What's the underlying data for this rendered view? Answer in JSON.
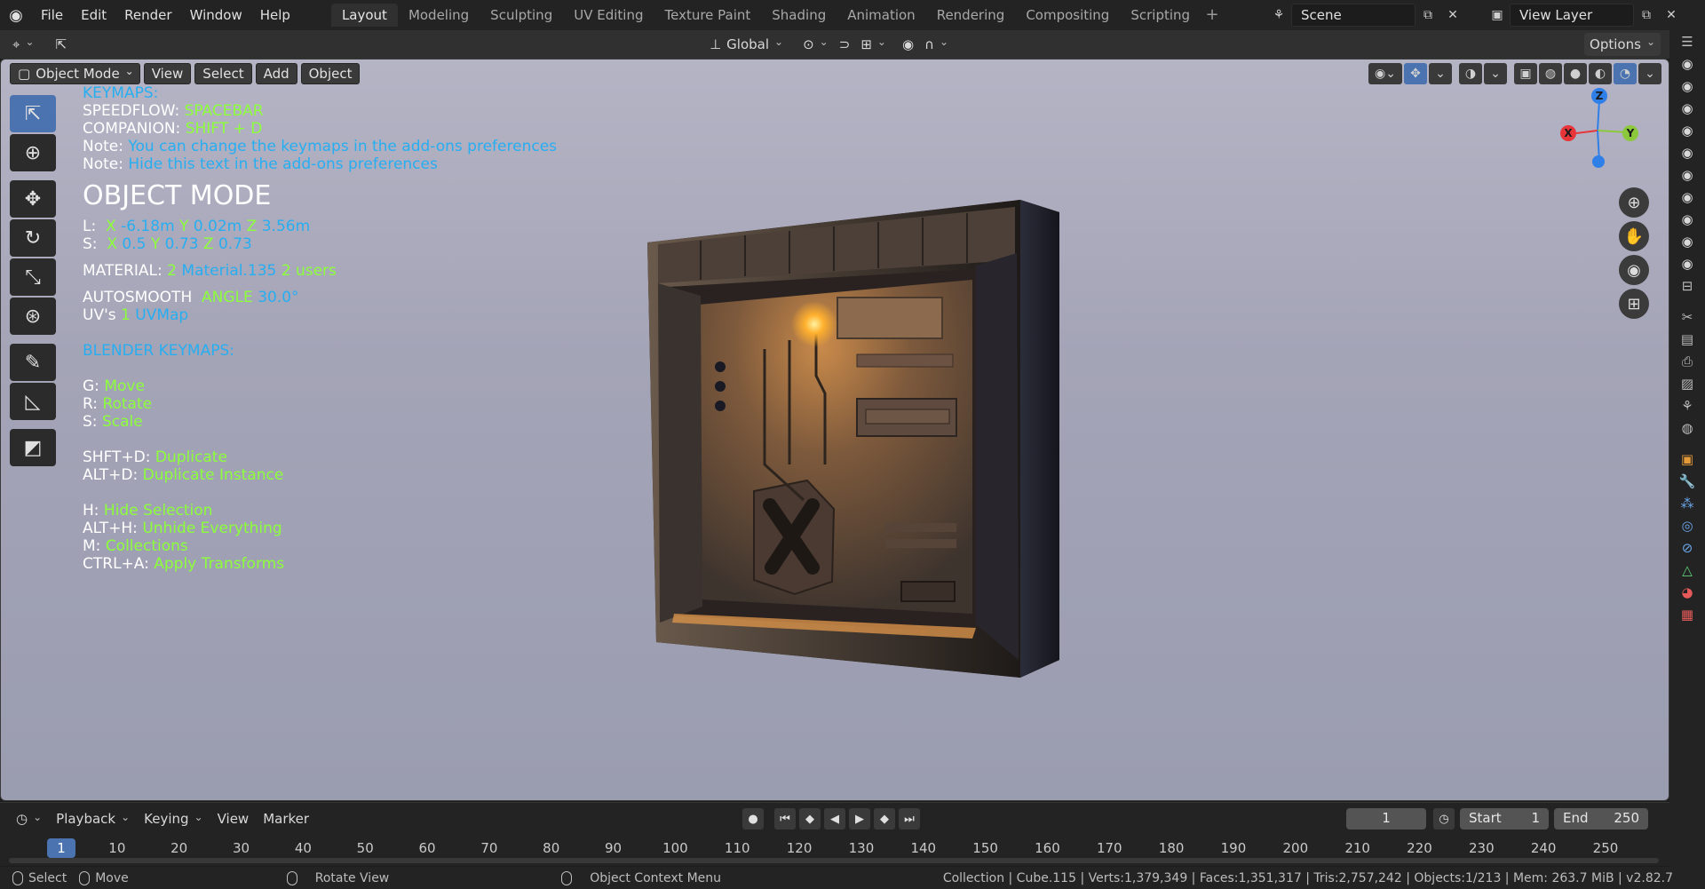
{
  "menu": [
    "File",
    "Edit",
    "Render",
    "Window",
    "Help"
  ],
  "workspaces": [
    "Layout",
    "Modeling",
    "Sculpting",
    "UV Editing",
    "Texture Paint",
    "Shading",
    "Animation",
    "Rendering",
    "Compositing",
    "Scripting"
  ],
  "active_workspace": "Layout",
  "scene": "Scene",
  "view_layer": "View Layer",
  "header": {
    "orientation": "Global",
    "options": "Options"
  },
  "viewport": {
    "mode": "Object Mode",
    "menus": [
      "View",
      "Select",
      "Add",
      "Object"
    ]
  },
  "overlay": {
    "keymaps_title": "KEYMAPS:",
    "speedflow_label": "SPEEDFLOW:",
    "speedflow_key": "SPACEBAR",
    "companion_label": "COMPANION:",
    "companion_key": "SHIFT + D",
    "note1_label": "Note:",
    "note1_text": "You can change the keymaps in the add-ons preferences",
    "note2_label": "Note:",
    "note2_text": "Hide this text in the add-ons preferences",
    "mode_title": "OBJECT MODE",
    "loc_label": "L:",
    "loc_x_axis": "X",
    "loc_x": "-6.18m",
    "loc_y_axis": "Y",
    "loc_y": "0.02m",
    "loc_z_axis": "Z",
    "loc_z": "3.56m",
    "scale_label": "S:",
    "scale_x_axis": "X",
    "scale_x": "0.5",
    "scale_y_axis": "Y",
    "scale_y": "0.73",
    "scale_z_axis": "Z",
    "scale_z": "0.73",
    "material_label": "MATERIAL:",
    "material_count": "2",
    "material_name": "Material.135",
    "material_users": "2 users",
    "autosmooth_label": "AUTOSMOOTH",
    "autosmooth_angle_label": "ANGLE",
    "autosmooth_angle": "30.0°",
    "uv_label": "UV's",
    "uv_count": "1",
    "uv_name": "UVMap",
    "blender_keymaps_title": "BLENDER KEYMAPS:",
    "keys": [
      {
        "k": "G:",
        "v": "Move"
      },
      {
        "k": "R:",
        "v": "Rotate"
      },
      {
        "k": "S:",
        "v": "Scale"
      },
      {
        "k": "SHFT+D:",
        "v": "Duplicate"
      },
      {
        "k": "ALT+D:",
        "v": "Duplicate Instance"
      },
      {
        "k": "H:",
        "v": "Hide Selection"
      },
      {
        "k": "ALT+H:",
        "v": "Unhide Everything"
      },
      {
        "k": "M:",
        "v": "Collections"
      },
      {
        "k": "CTRL+A:",
        "v": "Apply Transforms"
      }
    ]
  },
  "gizmo": {
    "z": "Z",
    "x": "X",
    "y": "Y"
  },
  "timeline": {
    "menus": [
      "Playback",
      "Keying",
      "View",
      "Marker"
    ],
    "current_frame": "1",
    "start_label": "Start",
    "start": "1",
    "end_label": "End",
    "end": "250",
    "ticks": [
      "1",
      "10",
      "20",
      "30",
      "40",
      "50",
      "60",
      "70",
      "80",
      "90",
      "100",
      "110",
      "120",
      "130",
      "140",
      "150",
      "160",
      "170",
      "180",
      "190",
      "200",
      "210",
      "220",
      "230",
      "240",
      "250"
    ]
  },
  "status": {
    "select": "Select",
    "move": "Move",
    "rotate_view": "Rotate View",
    "context_menu": "Object Context Menu",
    "info": "Collection | Cube.115 | Verts:1,379,349 | Faces:1,351,317 | Tris:2,757,242 | Objects:1/213 | Mem: 263.7 MiB | v2.82.7"
  },
  "colors": {
    "accent": "#4a73b0",
    "overlay_blue": "#27aef1",
    "overlay_green": "#8cff3a",
    "axis_x": "#e8353a",
    "axis_y": "#8cc83c",
    "axis_z": "#2f7fe8"
  }
}
